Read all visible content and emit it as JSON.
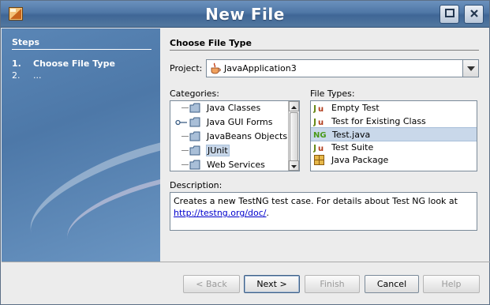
{
  "window": {
    "title": "New File",
    "icons": {
      "app": "netbeans-app-icon",
      "maximize": "maximize-icon",
      "close": "close-icon"
    }
  },
  "steps": {
    "heading": "Steps",
    "items": [
      {
        "num": "1.",
        "label": "Choose File Type",
        "current": true
      },
      {
        "num": "2.",
        "label": "...",
        "current": false
      }
    ]
  },
  "main": {
    "section_title": "Choose File Type",
    "project_label": "Project:",
    "project_value": "JavaApplication3",
    "categories_label": "Categories:",
    "categories": [
      {
        "label": "Java Classes",
        "selected": false
      },
      {
        "label": "Java GUI Forms",
        "selected": false
      },
      {
        "label": "JavaBeans Objects",
        "selected": false
      },
      {
        "label": "JUnit",
        "selected": true
      },
      {
        "label": "Web Services",
        "selected": false
      }
    ],
    "file_types_label": "File Types:",
    "file_types": [
      {
        "label": "Empty Test",
        "icon": "junit-icon",
        "selected": false
      },
      {
        "label": "Test for Existing Class",
        "icon": "junit-icon",
        "selected": false
      },
      {
        "label": "Test.java",
        "icon": "testng-icon",
        "selected": true
      },
      {
        "label": "Test Suite",
        "icon": "junit-icon",
        "selected": false
      },
      {
        "label": "Java Package",
        "icon": "package-icon",
        "selected": false
      }
    ],
    "description_label": "Description:",
    "description_text": "Creates a new TestNG test case. For details about Test NG look at",
    "description_link": "http://testng.org/doc/",
    "description_tail": "."
  },
  "buttons": {
    "back": "< Back",
    "next": "Next >",
    "finish": "Finish",
    "cancel": "Cancel",
    "help": "Help"
  },
  "colors": {
    "titlebar": "#4f77a6",
    "steps_panel": "#5a86b6",
    "selection": "#c9d8ea",
    "link": "#0000cc"
  }
}
